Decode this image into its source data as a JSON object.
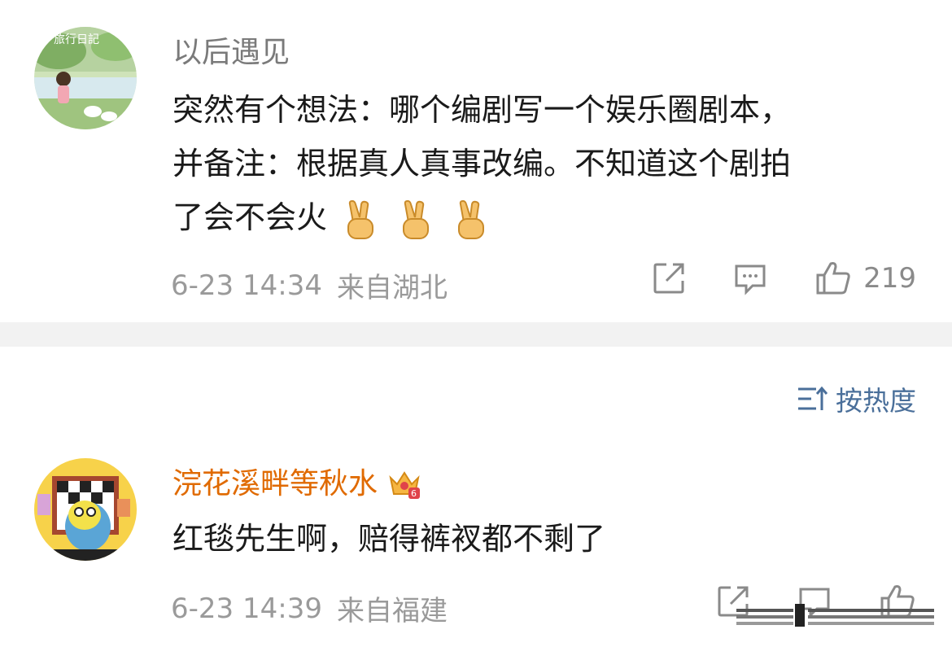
{
  "comments": [
    {
      "username": "以后遇见",
      "text_line1": "突然有个想法：哪个编剧写一个娱乐圈剧本，",
      "text_line2": "并备注：根据真人真事改编。不知道这个剧拍",
      "text_line3": "了会不会火",
      "emoji_count": 3,
      "date": "6-23 14:34",
      "location": "来自湖北",
      "like_count": "219",
      "avatar_text": "旅行日記"
    },
    {
      "username": "浣花溪畔等秋水",
      "text": "红毯先生啊，赔得裤衩都不剩了",
      "date": "6-23 14:39",
      "location": "来自福建",
      "badge": "6"
    }
  ],
  "sort": {
    "label": "按热度"
  },
  "colors": {
    "username_gray": "#7a7a7a",
    "username_orange": "#e06a00",
    "meta_gray": "#9a9a9a",
    "sort_blue": "#4a6f9a",
    "divider": "#f2f2f2"
  }
}
